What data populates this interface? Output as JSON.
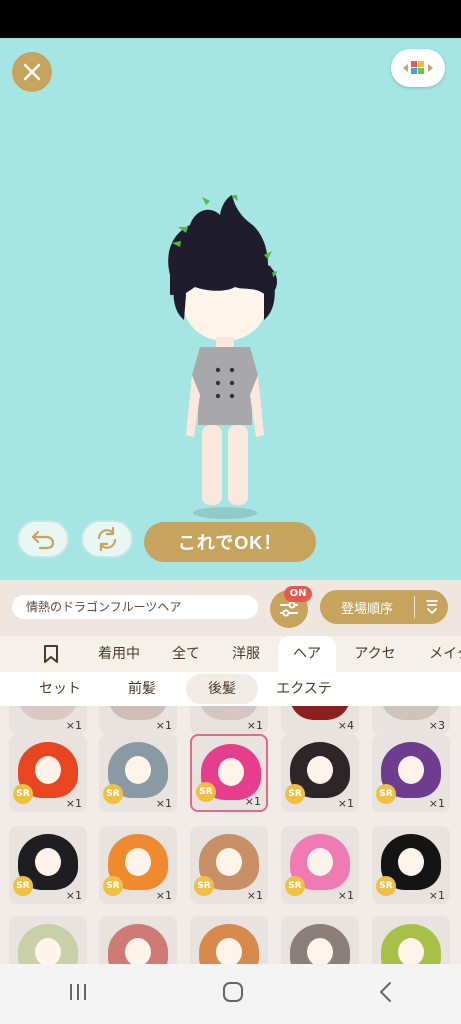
{
  "ok_button_label": "これでOK！",
  "item_name": "情熱のドラゴンフルーツヘア",
  "filter_badge": "ON",
  "sort_label": "登場順序",
  "tabs": [
    {
      "label": "",
      "icon": "bookmark-icon"
    },
    {
      "label": "着用中"
    },
    {
      "label": "全て"
    },
    {
      "label": "洋服"
    },
    {
      "label": "ヘア",
      "active": true
    },
    {
      "label": "アクセ"
    },
    {
      "label": "メイク"
    }
  ],
  "subtabs": [
    {
      "label": "セット"
    },
    {
      "label": "前髪"
    },
    {
      "label": "後髪",
      "selected": true
    },
    {
      "label": "エクステ"
    }
  ],
  "cards": [
    {
      "qty": "×1",
      "rarity": "",
      "color": "#d9c8c4"
    },
    {
      "qty": "×1",
      "rarity": "",
      "color": "#cdbfb8"
    },
    {
      "qty": "×1",
      "rarity": "",
      "color": "#d4c6c0"
    },
    {
      "qty": "×4",
      "rarity": "",
      "color": "#8c2020"
    },
    {
      "qty": "×3",
      "rarity": "",
      "color": "#cfc3be"
    },
    {
      "qty": "×1",
      "rarity": "SR",
      "color": "#e84520"
    },
    {
      "qty": "×1",
      "rarity": "SR",
      "color": "#8a9aa4"
    },
    {
      "qty": "×1",
      "rarity": "SR",
      "color": "#e63e8c",
      "selected": true
    },
    {
      "qty": "×1",
      "rarity": "SR",
      "color": "#2c2628"
    },
    {
      "qty": "×1",
      "rarity": "SR",
      "color": "#6e3d8f"
    },
    {
      "qty": "×1",
      "rarity": "SR",
      "color": "#1e1e22"
    },
    {
      "qty": "×1",
      "rarity": "SR",
      "color": "#f08a2e"
    },
    {
      "qty": "×1",
      "rarity": "SR",
      "color": "#c99068"
    },
    {
      "qty": "×1",
      "rarity": "SR",
      "color": "#f07ab4"
    },
    {
      "qty": "×1",
      "rarity": "SR",
      "color": "#141414"
    },
    {
      "qty": "",
      "rarity": "",
      "color": "#c9cfa8"
    },
    {
      "qty": "",
      "rarity": "",
      "color": "#cf7a74"
    },
    {
      "qty": "",
      "rarity": "",
      "color": "#d78a4c"
    },
    {
      "qty": "",
      "rarity": "",
      "color": "#8c7f7a"
    },
    {
      "qty": "",
      "rarity": "",
      "color": "#a8c048"
    }
  ],
  "colors": {
    "stage_bg": "#a5e6e4",
    "accent_gold": "#c7a45e",
    "selected_border": "#e06b8a",
    "badge_red": "#e65a4d"
  }
}
